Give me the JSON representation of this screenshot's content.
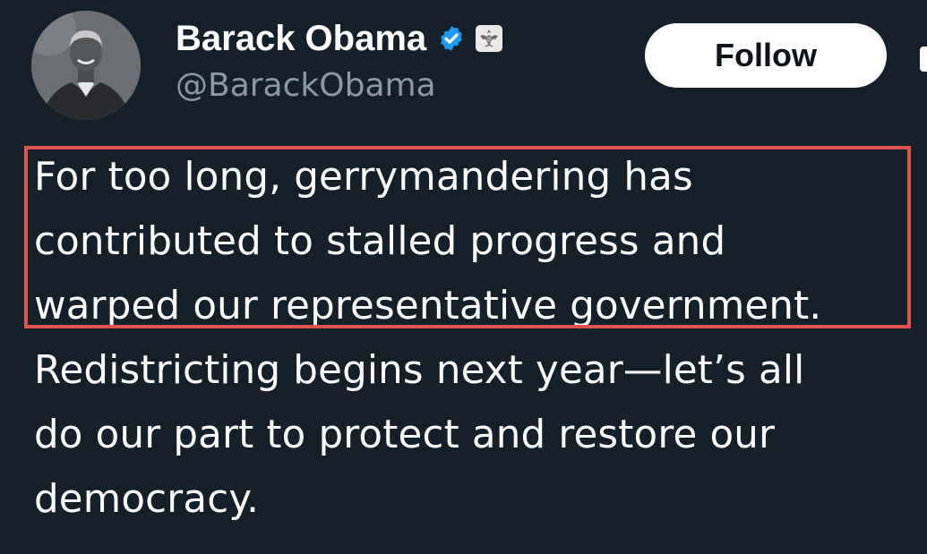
{
  "author": {
    "display_name": "Barack Obama",
    "handle": "@BarackObama",
    "avatar_icon": "profile-photo",
    "verified_icon": "verified-badge-icon",
    "affiliation_icon": "government-seal-icon"
  },
  "actions": {
    "follow_label": "Follow"
  },
  "tweet": {
    "lines": [
      "For too long, gerrymandering has",
      "contributed to stalled progress and",
      "warped our representative government.",
      "Redistricting begins next year—let’s all",
      "do our part to protect and restore our",
      "democracy."
    ],
    "highlighted_lines": [
      0,
      1,
      2
    ]
  },
  "colors": {
    "background": "#15202b",
    "text": "#ffffff",
    "secondary_text": "#8b98a5",
    "verified_blue": "#1d9bf0",
    "highlight_border": "#e0534a",
    "follow_button_bg": "#ffffff"
  }
}
